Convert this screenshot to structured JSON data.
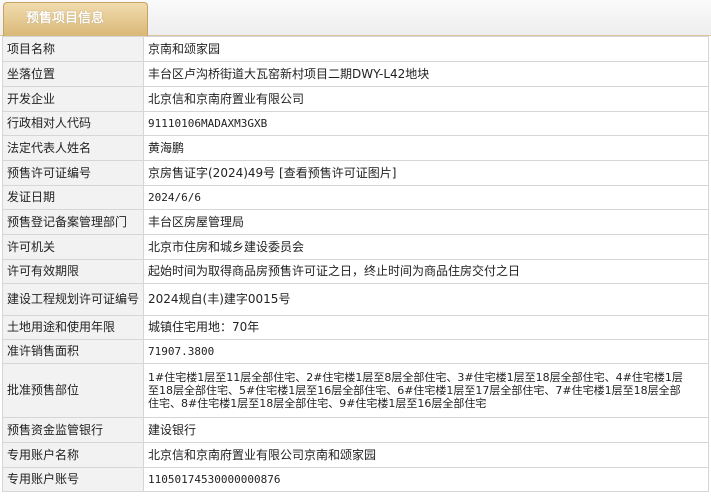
{
  "header": {
    "tab_title": "预售项目信息"
  },
  "rows": [
    {
      "label": "项目名称",
      "value": "京南和颂家园"
    },
    {
      "label": "坐落位置",
      "value": "丰台区卢沟桥街道大瓦窑新村项目二期DWY-L42地块"
    },
    {
      "label": "开发企业",
      "value": "北京信和京南府置业有限公司"
    },
    {
      "label": "行政相对人代码",
      "value": "91110106MADAXM3GXB"
    },
    {
      "label": "法定代表人姓名",
      "value": "黄海鹏"
    },
    {
      "label": "预售许可证编号",
      "value": "京房售证字(2024)49号",
      "link": "[查看预售许可证图片]"
    },
    {
      "label": "发证日期",
      "value": "2024/6/6"
    },
    {
      "label": "预售登记备案管理部门",
      "value": "丰台区房屋管理局"
    },
    {
      "label": "许可机关",
      "value": "北京市住房和城乡建设委员会"
    },
    {
      "label": "许可有效期限",
      "value": "起始时间为取得商品房预售许可证之日，终止时间为商品住房交付之日"
    },
    {
      "label": "建设工程规划许可证编号",
      "value": "2024规自(丰)建字0015号"
    },
    {
      "label": "土地用途和使用年限",
      "value": "城镇住宅用地：70年"
    },
    {
      "label": "准许销售面积",
      "value": "71907.3800"
    },
    {
      "label": "批准预售部位",
      "lines": [
        "1#住宅楼1层至11层全部住宅、2#住宅楼1层至8层全部住宅、3#住宅楼1层至18层全部住宅、4#住宅楼1层",
        "至18层全部住宅、5#住宅楼1层至16层全部住宅、6#住宅楼1层至17层全部住宅、7#住宅楼1层至18层全部",
        "住宅、8#住宅楼1层至18层全部住宅、9#住宅楼1层至16层全部住宅"
      ]
    },
    {
      "label": "预售资金监管银行",
      "value": "建设银行"
    },
    {
      "label": "专用账户名称",
      "value": "北京信和京南府置业有限公司京南和颂家园"
    },
    {
      "label": "专用账户账号",
      "value": "11050174530000000876"
    }
  ]
}
